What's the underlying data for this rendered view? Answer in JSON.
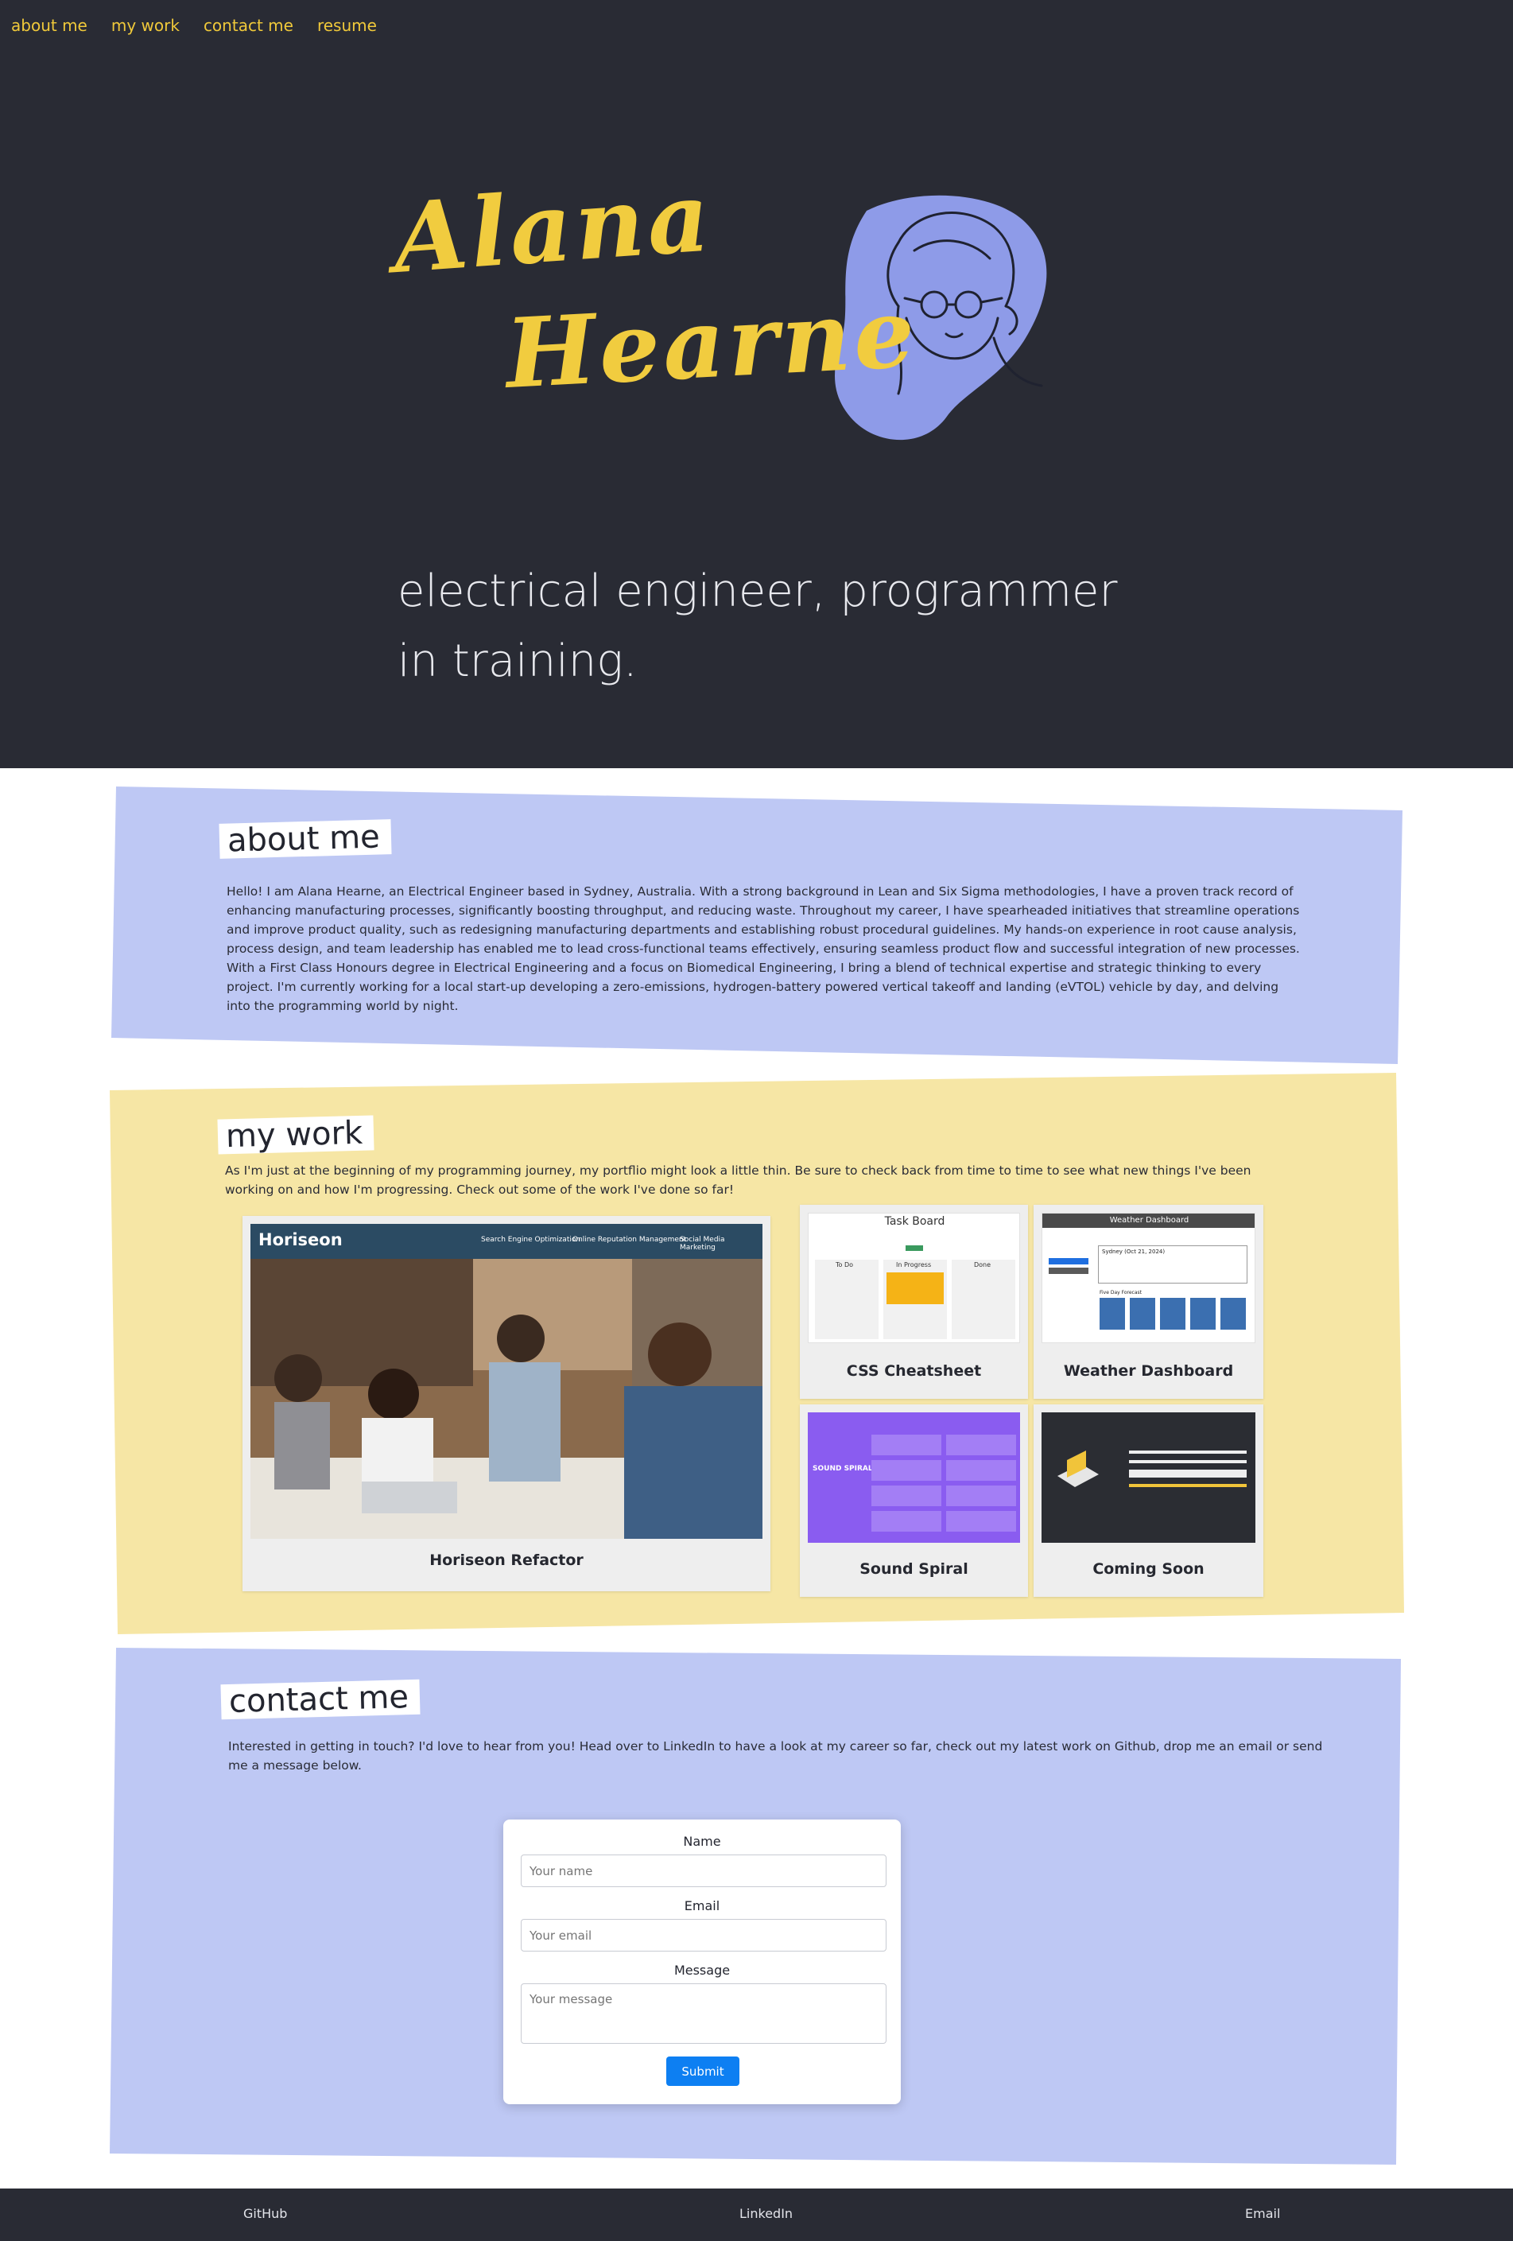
{
  "nav": {
    "items": [
      "about me",
      "my work",
      "contact me",
      "resume"
    ]
  },
  "hero": {
    "logo_line1": "Alana",
    "logo_line2": "Hearne",
    "tagline": "electrical engineer, programmer in training.",
    "colors": {
      "background": "#292b34",
      "accent": "#f1cc3f",
      "blob": "#8e9be8"
    }
  },
  "about": {
    "title": "about me",
    "text": "Hello! I am Alana Hearne, an Electrical Engineer based in Sydney, Australia. With a strong background in Lean and Six Sigma methodologies, I have a proven track record of enhancing manufacturing processes, significantly boosting throughput, and reducing waste. Throughout my career, I have spearheaded initiatives that streamline operations and improve product quality, such as redesigning manufacturing departments and establishing robust procedural guidelines. My hands-on experience in root cause analysis, process design, and team leadership has enabled me to lead cross-functional teams effectively, ensuring seamless product flow and successful integration of new processes. With a First Class Honours degree in Electrical Engineering and a focus on Biomedical Engineering, I bring a blend of technical expertise and strategic thinking to every project. I'm currently working for a local start-up developing a zero-emissions, hydrogen-battery powered vertical takeoff and landing (eVTOL) vehicle by day, and delving into the programming world by night."
  },
  "work": {
    "title": "my work",
    "text": "As I'm just at the beginning of my programming journey, my portflio might look a little thin. Be sure to check back from time to time to see what new things I've been working on and how I'm progressing. Check out some of the work I've done so far!",
    "projects": [
      {
        "title": "Horiseon Refactor"
      },
      {
        "title": "CSS Cheatsheet"
      },
      {
        "title": "Weather Dashboard"
      },
      {
        "title": "Sound Spiral"
      },
      {
        "title": "Coming Soon"
      }
    ],
    "shots": {
      "horiseon": {
        "brand": "Horiseon",
        "links": [
          "Search Engine Optimization",
          "Online Reputation Management",
          "Social Media Marketing"
        ]
      },
      "taskboard": {
        "title": "Task Board",
        "cols": [
          "To Do",
          "In Progress",
          "Done"
        ]
      },
      "weather": {
        "title": "Weather Dashboard",
        "city": "Sydney (Oct 21, 2024)",
        "forecast_label": "Five Day Forecast"
      },
      "spiral": {
        "logo": "SOUND SPIRAL"
      }
    }
  },
  "contact": {
    "title": "contact me",
    "text": "Interested in getting in touch? I'd love to hear from you! Head over to LinkedIn to have a look at my career so far, check out my latest work on Github, drop me an email or send me a message below.",
    "form": {
      "name_label": "Name",
      "name_placeholder": "Your name",
      "email_label": "Email",
      "email_placeholder": "Your email",
      "message_label": "Message",
      "message_placeholder": "Your message",
      "submit": "Submit"
    }
  },
  "footer": {
    "links": [
      "GitHub",
      "LinkedIn",
      "Email"
    ]
  },
  "colors": {
    "panel_blue": "#bec8f4",
    "panel_yellow": "#f6e6a5",
    "dark": "#292b34",
    "button_blue": "#0d7ff2"
  }
}
